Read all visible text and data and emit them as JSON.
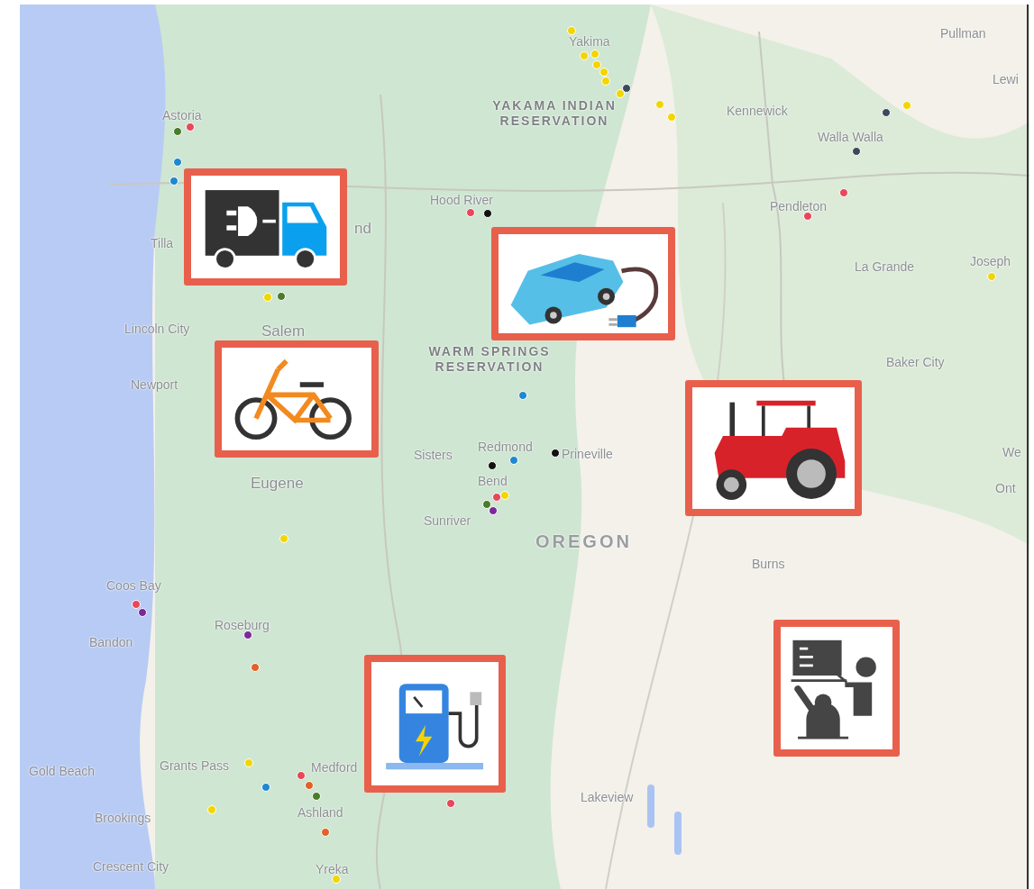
{
  "map": {
    "labels": [
      {
        "text": "Yakima",
        "kind": "city"
      },
      {
        "text": "Pullman",
        "kind": "city"
      },
      {
        "text": "Lewi",
        "kind": "city"
      },
      {
        "text": "YAKAMA INDIAN RESERVATION",
        "kind": "region"
      },
      {
        "text": "Kennewick",
        "kind": "city"
      },
      {
        "text": "Astoria",
        "kind": "city"
      },
      {
        "text": "Walla Walla",
        "kind": "city"
      },
      {
        "text": "Hood River",
        "kind": "city"
      },
      {
        "text": "Pendleton",
        "kind": "city"
      },
      {
        "text": "nd",
        "kind": "major"
      },
      {
        "text": "Tilla",
        "kind": "city"
      },
      {
        "text": "La Grande",
        "kind": "city"
      },
      {
        "text": "Joseph",
        "kind": "city"
      },
      {
        "text": "Salem",
        "kind": "major"
      },
      {
        "text": "Lincoln City",
        "kind": "city"
      },
      {
        "text": "WARM SPRINGS RESERVATION",
        "kind": "region"
      },
      {
        "text": "Baker City",
        "kind": "city"
      },
      {
        "text": "Newport",
        "kind": "city"
      },
      {
        "text": "Sisters",
        "kind": "city"
      },
      {
        "text": "Redmond",
        "kind": "city"
      },
      {
        "text": "Prineville",
        "kind": "city"
      },
      {
        "text": "We",
        "kind": "city"
      },
      {
        "text": "Eugene",
        "kind": "major"
      },
      {
        "text": "Bend",
        "kind": "city"
      },
      {
        "text": "Sunriver",
        "kind": "city"
      },
      {
        "text": "OREGON",
        "kind": "state"
      },
      {
        "text": "Ont",
        "kind": "city"
      },
      {
        "text": "Burns",
        "kind": "city"
      },
      {
        "text": "Coos Bay",
        "kind": "city"
      },
      {
        "text": "Roseburg",
        "kind": "city"
      },
      {
        "text": "Bandon",
        "kind": "city"
      },
      {
        "text": "Gold Beach",
        "kind": "city"
      },
      {
        "text": "Grants Pass",
        "kind": "city"
      },
      {
        "text": "Medford",
        "kind": "city"
      },
      {
        "text": "Lakeview",
        "kind": "city"
      },
      {
        "text": "Brookings",
        "kind": "city"
      },
      {
        "text": "Ashland",
        "kind": "city"
      },
      {
        "text": "Crescent City",
        "kind": "city"
      },
      {
        "text": "Yreka",
        "kind": "city"
      }
    ],
    "markers": [
      {
        "color": "#f2d600"
      },
      {
        "color": "#f2d600"
      },
      {
        "color": "#f2d600"
      },
      {
        "color": "#f2d600"
      },
      {
        "color": "#f2d600"
      },
      {
        "color": "#f2d600"
      },
      {
        "color": "#f2d600"
      },
      {
        "color": "#3b4a5a"
      },
      {
        "color": "#f2d600"
      },
      {
        "color": "#f2d600"
      },
      {
        "color": "#f2d600"
      },
      {
        "color": "#3b4a5a"
      },
      {
        "color": "#3b4a5a"
      },
      {
        "color": "#e8475a"
      },
      {
        "color": "#e8475a"
      },
      {
        "color": "#f2d600"
      },
      {
        "color": "#4a7c2c"
      },
      {
        "color": "#e8475a"
      },
      {
        "color": "#1e88d0"
      },
      {
        "color": "#1e88d0"
      },
      {
        "color": "#f2d600"
      },
      {
        "color": "#4a7c2c"
      },
      {
        "color": "#e8475a"
      },
      {
        "color": "#111111"
      },
      {
        "color": "#1e88d0"
      },
      {
        "color": "#1e88d0"
      },
      {
        "color": "#111111"
      },
      {
        "color": "#111111"
      },
      {
        "color": "#f2d600"
      },
      {
        "color": "#e8475a"
      },
      {
        "color": "#4a7c2c"
      },
      {
        "color": "#7b2a9a"
      },
      {
        "color": "#f2d600"
      },
      {
        "color": "#e8475a"
      },
      {
        "color": "#7b2a9a"
      },
      {
        "color": "#7b2a9a"
      },
      {
        "color": "#e0622a"
      },
      {
        "color": "#f2d600"
      },
      {
        "color": "#1e88d0"
      },
      {
        "color": "#e8475a"
      },
      {
        "color": "#e0622a"
      },
      {
        "color": "#4a7c2c"
      },
      {
        "color": "#f2d600"
      },
      {
        "color": "#e0622a"
      },
      {
        "color": "#e8475a"
      },
      {
        "color": "#f2d600"
      }
    ],
    "cards": [
      {
        "kind": "truck"
      },
      {
        "kind": "car"
      },
      {
        "kind": "bicycle"
      },
      {
        "kind": "tractor"
      },
      {
        "kind": "charger"
      },
      {
        "kind": "teacher"
      }
    ]
  }
}
